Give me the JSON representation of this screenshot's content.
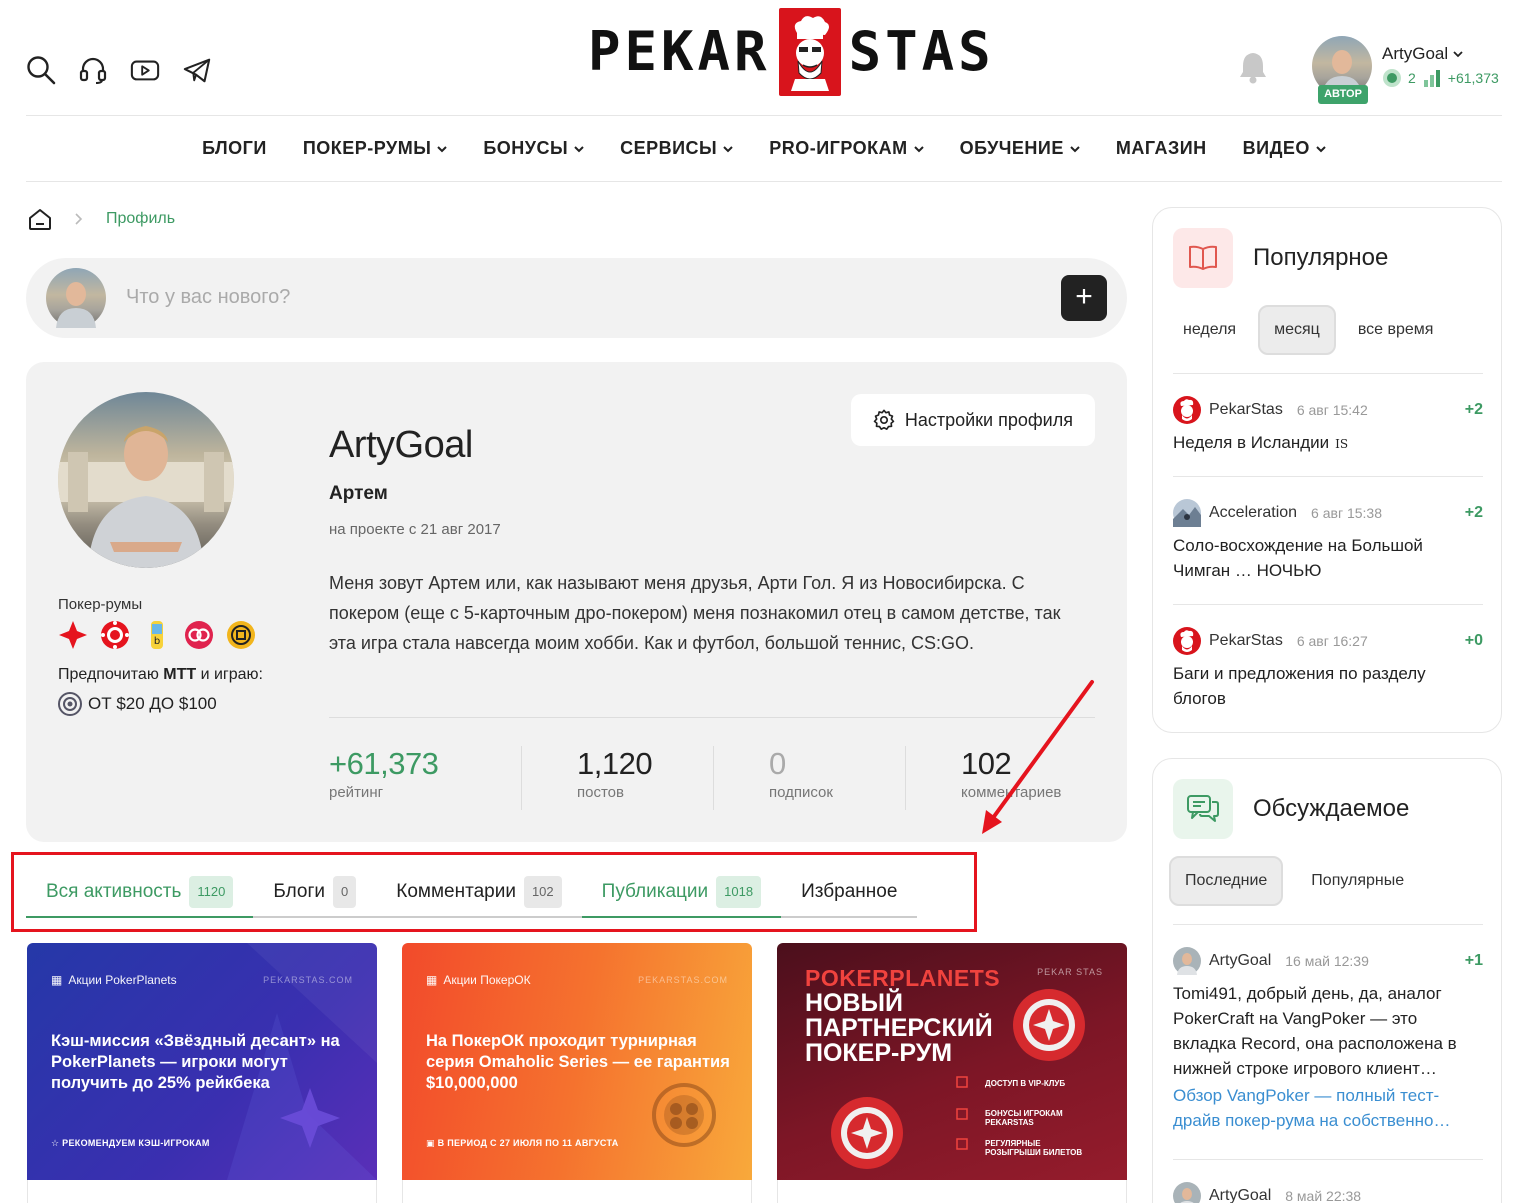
{
  "header": {
    "logo_left": "PEKAR",
    "logo_right": "STAS",
    "user": {
      "name": "ArtyGoal",
      "badge": "АВТОР",
      "level": "2",
      "rating": "+61,373"
    }
  },
  "nav": {
    "items": [
      {
        "label": "БЛОГИ",
        "dropdown": false
      },
      {
        "label": "ПОКЕР-РУМЫ",
        "dropdown": true
      },
      {
        "label": "БОНУСЫ",
        "dropdown": true
      },
      {
        "label": "СЕРВИСЫ",
        "dropdown": true
      },
      {
        "label": "PRO-ИГРОКАМ",
        "dropdown": true
      },
      {
        "label": "ОБУЧЕНИЕ",
        "dropdown": true
      },
      {
        "label": "МАГАЗИН",
        "dropdown": false
      },
      {
        "label": "ВИДЕО",
        "dropdown": true
      }
    ]
  },
  "breadcrumb": {
    "current": "Профиль"
  },
  "composer": {
    "placeholder": "Что у вас нового?",
    "add": "+"
  },
  "profile": {
    "settings_label": "Настройки профиля",
    "username": "ArtyGoal",
    "real_name": "Артем",
    "since": "на проекте с 21 авг 2017",
    "bio": "Меня зовут Артем или, как называют меня друзья, Арти Гол. Я из Новосибирска. С покером (еще с 5-карточным дро-покером) меня познакомил отец в самом детстве, так эта игра стала навсегда моим хобби. Как и футбол, большой теннис, CS:GO.",
    "poker_rooms_label": "Покер-румы",
    "pref_text_before": "Предпочитаю ",
    "pref_format": "MTT",
    "pref_text_after": " и играю:",
    "limits": "ОТ $20 ДО $100",
    "stats": [
      {
        "value": "+61,373",
        "label": "рейтинг",
        "color": "#3d9a63"
      },
      {
        "value": "1,120",
        "label": "постов",
        "color": "#222222"
      },
      {
        "value": "0",
        "label": "подписок",
        "color": "#aaaaaa"
      },
      {
        "value": "102",
        "label": "комментариев",
        "color": "#222222"
      }
    ]
  },
  "tabs": [
    {
      "label": "Вся активность",
      "count": "1120",
      "active": true
    },
    {
      "label": "Блоги",
      "count": "0",
      "active": false
    },
    {
      "label": "Комментарии",
      "count": "102",
      "active": false
    },
    {
      "label": "Публикации",
      "count": "1018",
      "active": true
    },
    {
      "label": "Избранное",
      "count": "",
      "active": false
    }
  ],
  "cards": [
    {
      "tag": "Акции PokerPlanets",
      "brand": "PEKARSTAS.COM",
      "title": "Кэш-миссия «Звёздный десант» на PokerPlanets — игроки могут получить до 25% рейкбека",
      "footer": "☆ РЕКОМЕНДУЕМ КЭШ-ИГРОКАМ",
      "colors": [
        "#2538a8",
        "#5a2fb8"
      ]
    },
    {
      "tag": "Акции ПокерОК",
      "brand": "PEKARSTAS.COM",
      "title": "На ПокерОК проходит турнирная серия Omaholic Series — ее гарантия $10,000,000",
      "footer": "В ПЕРИОД С 27 ИЮЛЯ ПО 11 АВГУСТА",
      "colors": [
        "#f25b2a",
        "#f7a13a"
      ]
    },
    {
      "brand_small": "PEKAR STAS",
      "big": "POKERPLANETS",
      "title": "НОВЫЙ ПАРТНЕРСКИЙ ПОКЕР-РУМ",
      "features": [
        "ДОСТУП В VIP-КЛУБ",
        "БОНУСЫ ИГРОКАМ PEKARSTAS",
        "РЕГУЛЯРНЫЕ РОЗЫГРЫШИ БИЛЕТОВ"
      ],
      "colors": [
        "#5a1220",
        "#8e1a2a"
      ]
    }
  ],
  "popular": {
    "title": "Популярное",
    "filters": [
      {
        "label": "неделя",
        "active": false
      },
      {
        "label": "месяц",
        "active": true
      },
      {
        "label": "все время",
        "active": false
      }
    ],
    "items": [
      {
        "author": "PekarStas",
        "time": "6 авг 15:42",
        "score": "+2",
        "title": "Неделя в Исландии",
        "suffix": "IS",
        "avatar": "pekarstas"
      },
      {
        "author": "Acceleration",
        "time": "6 авг 15:38",
        "score": "+2",
        "title": "Соло-восхождение на Большой Чимган … НОЧЬЮ",
        "avatar": "acceleration"
      },
      {
        "author": "PekarStas",
        "time": "6 авг 16:27",
        "score": "+0",
        "title": "Баги и предложения по разделу блогов",
        "avatar": "pekarstas"
      }
    ]
  },
  "discussed": {
    "title": "Обсуждаемое",
    "filters": [
      {
        "label": "Последние",
        "active": true
      },
      {
        "label": "Популярные",
        "active": false
      }
    ],
    "items": [
      {
        "author": "ArtyGoal",
        "time": "16 май 12:39",
        "score": "+1",
        "title": "Tomi491, добрый день, да, аналог PokerCraft на VangPoker — это вкладка Record, она расположена в нижней строке игрового клиент…",
        "link": "Обзор VangPoker — полный тест-драйв покер-рума на собственно…"
      },
      {
        "author": "ArtyGoal",
        "time": "8 май 22:38"
      }
    ]
  },
  "colors": {
    "accent": "#3d9a63",
    "link": "#3a8ed1",
    "annotation": "#e5141e",
    "brand_red": "#d8141c"
  }
}
